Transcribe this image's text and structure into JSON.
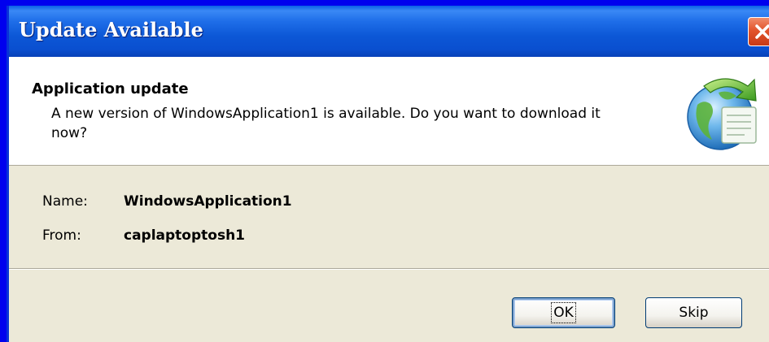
{
  "window": {
    "title": "Update Available"
  },
  "header": {
    "title": "Application update",
    "description": "A new version of WindowsApplication1 is available. Do you want to download it now?"
  },
  "details": {
    "name_label": "Name:",
    "name_value": "WindowsApplication1",
    "from_label": "From:",
    "from_value": "caplaptoptosh1"
  },
  "buttons": {
    "ok_label": "OK",
    "skip_label": "Skip"
  },
  "icons": {
    "close": "close-icon",
    "app": "globe-update-icon"
  }
}
